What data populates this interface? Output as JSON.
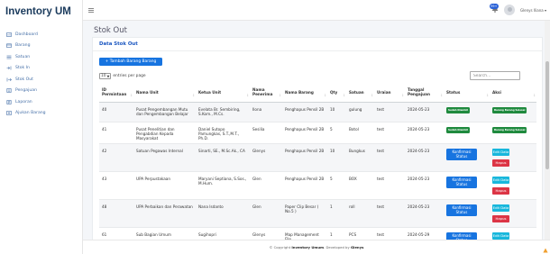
{
  "app": {
    "brand": "Inventory UM"
  },
  "sidebar": {
    "items": [
      {
        "label": "Dashboard",
        "icon": "dashboard-icon"
      },
      {
        "label": "Barang",
        "icon": "box-icon"
      },
      {
        "label": "Satuan",
        "icon": "list-icon"
      },
      {
        "label": "Stok In",
        "icon": "stock-in-icon"
      },
      {
        "label": "Stok Out",
        "icon": "stock-out-icon"
      },
      {
        "label": "Pengajuan",
        "icon": "submission-icon"
      },
      {
        "label": "Laporan",
        "icon": "report-icon"
      },
      {
        "label": "Ajukan Barang",
        "icon": "request-icon"
      }
    ]
  },
  "topbar": {
    "notification_count": "99+",
    "user_name": "Glenys Iliana ▾"
  },
  "page": {
    "title": "Stok Out"
  },
  "card": {
    "title": "Data Stok Out",
    "add_button_label": "+ Tambah Barang Barang",
    "entries_value": "10",
    "entries_suffix": "entries per page",
    "search_placeholder": "Search..."
  },
  "table": {
    "headers": [
      "ID Permintaan",
      "Nama Unit",
      "Ketua Unit",
      "Nama Penerima",
      "Nama Barang",
      "Qty",
      "Satuan",
      "Uraian",
      "Tanggal Pengajuan",
      "Status",
      "Aksi"
    ],
    "rows": [
      {
        "id": "40",
        "unit": "Pusat Pengembangan Mutu dan Pengembangan Belajar",
        "ketua": "Evelata Br. Sembiring, S.Kom., M.Cs.",
        "penerima": "Ilona",
        "barang": "Penghapus Pensil 2B",
        "qty": "10",
        "satuan": "gulung",
        "uraian": "test",
        "tanggal": "2024-05-23",
        "status": "Sudah Diambil",
        "aksi_badge": "Barang Barang Selesai",
        "kind": "done"
      },
      {
        "id": "41",
        "unit": "Pusat Penelitian dan Pengabdian Kepada Masyarakat",
        "ketua": "Daniel Sutopo Pamungkas, S.T.,M.T., Ph.D.",
        "penerima": "Sesilia",
        "barang": "Penghapus Pensil 2B",
        "qty": "5",
        "satuan": "Botol",
        "uraian": "test",
        "tanggal": "2024-05-23",
        "status": "Sudah Diambil",
        "aksi_badge": "Barang Barang Selesai",
        "kind": "done"
      },
      {
        "id": "42",
        "unit": "Satuan Pegawas Internal",
        "ketua": "Sinarti, SE., M.Sc.Ak., CA",
        "penerima": "Glenys",
        "barang": "Penghapus Pensil 2B",
        "qty": "10",
        "satuan": "Bungkus",
        "uraian": "test",
        "tanggal": "2024-05-23",
        "status": "Konfirmasi Status",
        "edit": "Edit Data",
        "hapus": "Hapus",
        "kind": "pending"
      },
      {
        "id": "43",
        "unit": "UPA Perpustakaan",
        "ketua": "Maryani Septiana, S.Sos., M.Hum.",
        "penerima": "Glen",
        "barang": "Penghapus Pensil 2B",
        "qty": "5",
        "satuan": "BOX",
        "uraian": "test",
        "tanggal": "2024-05-23",
        "status": "Konfirmasi Status",
        "edit": "Edit Data",
        "hapus": "Hapus",
        "kind": "pending"
      },
      {
        "id": "48",
        "unit": "UPA Perbaikan dan Perawatan",
        "ketua": "Nana Isdanto",
        "penerima": "Glen",
        "barang": "Paper Clip Besar ( No.5 )",
        "qty": "1",
        "satuan": "roll",
        "uraian": "test",
        "tanggal": "2024-05-23",
        "status": "Konfirmasi Status",
        "edit": "Edit Data",
        "hapus": "Hapus",
        "kind": "pending"
      },
      {
        "id": "61",
        "unit": "Sub Bagian Umum",
        "ketua": "Sugihopri",
        "penerima": "Glenys",
        "barang": "Map Management File",
        "qty": "1",
        "satuan": "PCS",
        "uraian": "test",
        "tanggal": "2024-05-29",
        "status": "Konfirmasi Status",
        "edit": "Edit Data",
        "hapus": "Hapus",
        "kind": "pending"
      }
    ]
  },
  "footer": {
    "prefix": "© Copyright ",
    "brand": "Inventory Umum",
    "middle": ". Developed by ",
    "author": "Glenys"
  },
  "colors": {
    "primary": "#1774e0",
    "info": "#18b7dc",
    "danger": "#dc3545",
    "success": "#1f8a3e",
    "brand": "#1a3a5c"
  }
}
